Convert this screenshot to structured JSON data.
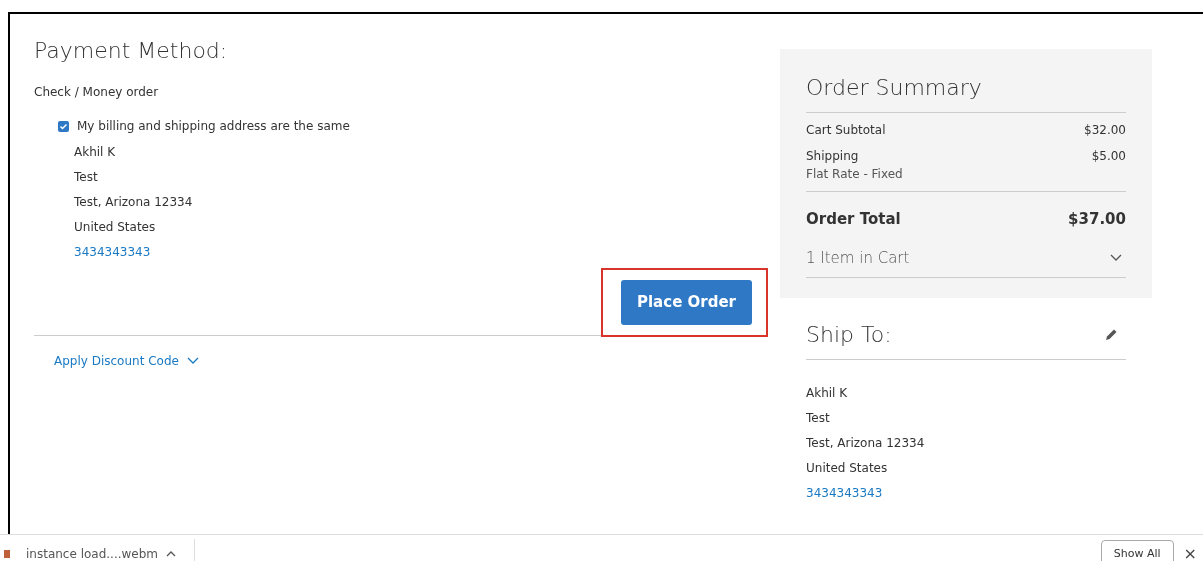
{
  "payment": {
    "title": "Payment Method:",
    "method": "Check / Money order",
    "same_address": {
      "label": "My billing and shipping address are the same",
      "checked": true
    },
    "address": [
      "Akhil K",
      "Test",
      "Test, Arizona 12334",
      "United States"
    ],
    "phone": "3434343343",
    "place_order": {
      "label": "Place Order",
      "highlighted": true
    },
    "discount": {
      "label": "Apply Discount Code",
      "expanded": false
    }
  },
  "summary": {
    "title": "Order Summary",
    "rows": [
      {
        "label": "Cart Subtotal",
        "value": "$32.00"
      },
      {
        "label": "Shipping",
        "sublabel": "Flat Rate - Fixed",
        "value": "$5.00"
      }
    ],
    "total": {
      "label": "Order Total",
      "value": "$37.00"
    },
    "cart": {
      "label": "1 Item in Cart",
      "expanded": false
    }
  },
  "ship_to": {
    "title": "Ship To:",
    "address": [
      "Akhil K",
      "Test",
      "Test, Arizona 12334",
      "United States"
    ],
    "phone": "3434343343"
  },
  "download_bar": {
    "file": "instance load....webm",
    "show_all": "Show All",
    "close": "×"
  }
}
